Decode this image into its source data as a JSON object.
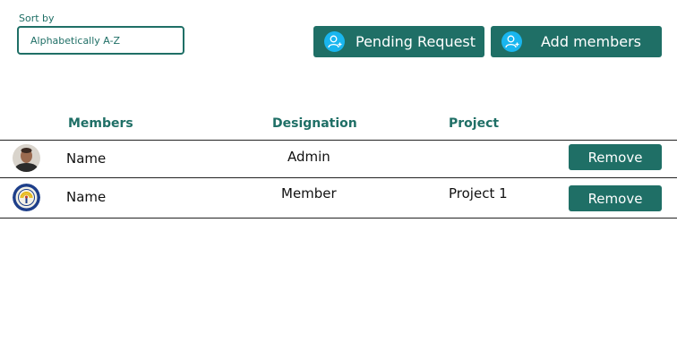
{
  "sort": {
    "label": "Sort by",
    "selected": "Alphabetically A-Z"
  },
  "actions": {
    "pending_label": "Pending Request",
    "add_label": "Add members",
    "icon": "add-user-icon"
  },
  "colors": {
    "primary": "#1f6f66",
    "icon_bg": "#19b6ef"
  },
  "table": {
    "headers": [
      "Members",
      "Designation",
      "Project"
    ],
    "rows": [
      {
        "name": "Name",
        "designation": "Admin",
        "project": "",
        "action": "Remove",
        "avatar": "person-photo"
      },
      {
        "name": "Name",
        "designation": "Member",
        "project": "Project 1",
        "action": "Remove",
        "avatar": "emblem-logo"
      }
    ]
  }
}
